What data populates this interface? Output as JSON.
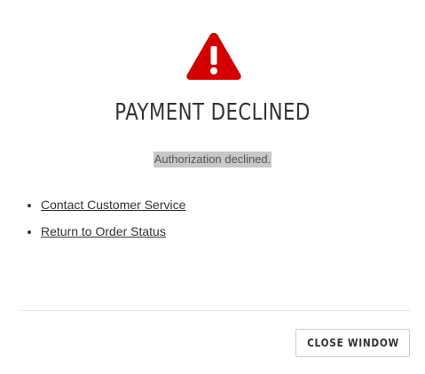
{
  "dialog": {
    "icon": "warning-triangle-icon",
    "icon_color": "#d40000",
    "title": "PAYMENT DECLINED",
    "message": "Authorization declined.",
    "links": [
      {
        "label": "Contact Customer Service"
      },
      {
        "label": "Return to Order Status"
      }
    ],
    "close_label": "CLOSE WINDOW"
  }
}
